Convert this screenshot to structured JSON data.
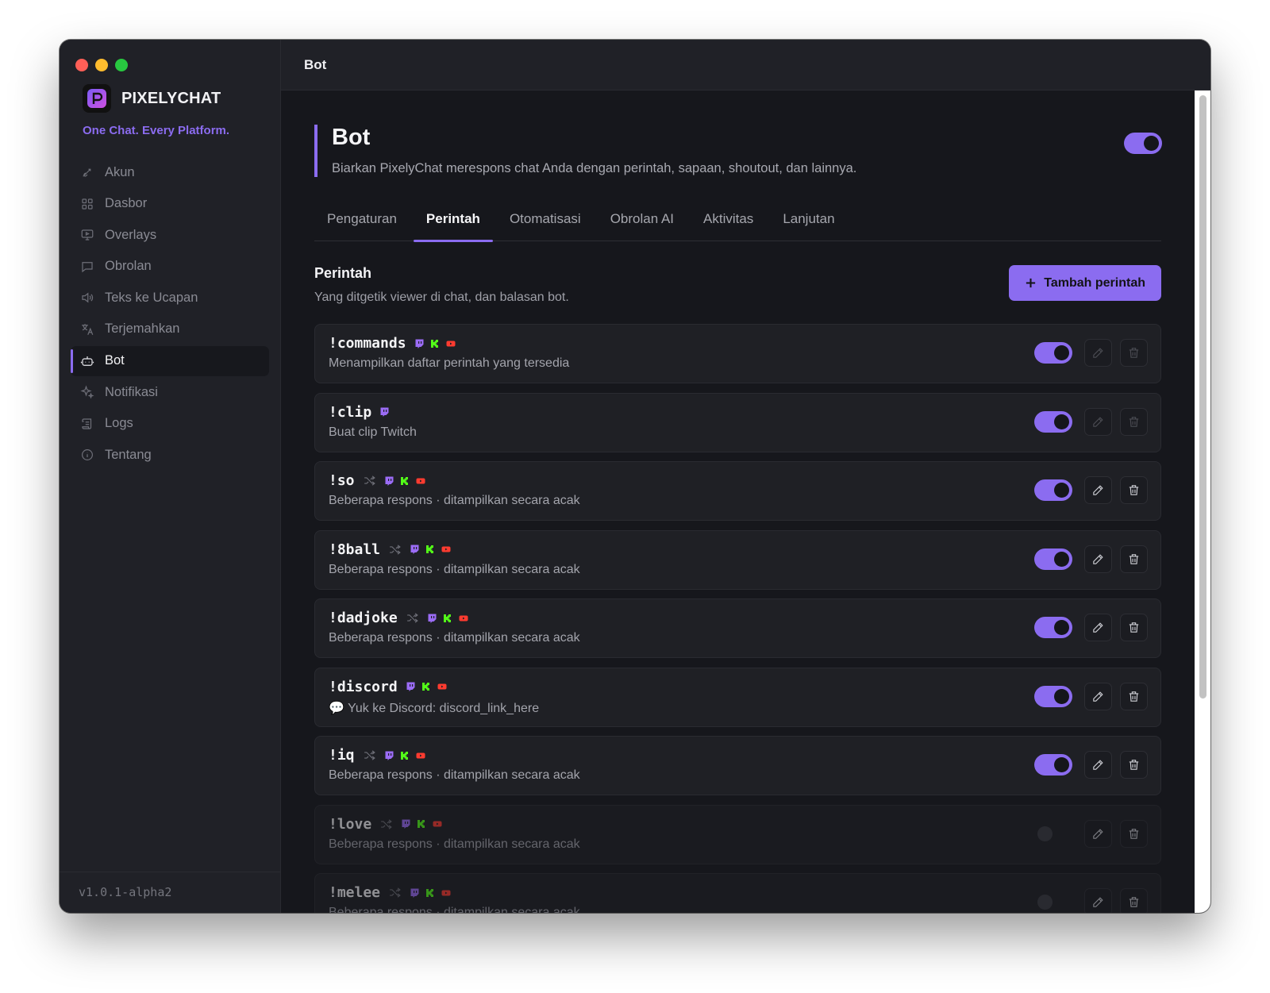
{
  "app": {
    "name": "PIXELYCHAT",
    "tagline": "One Chat. Every Platform.",
    "version": "v1.0.1-alpha2",
    "accent": "#8b6cf0"
  },
  "window": {
    "title": "Bot"
  },
  "sidebar": {
    "items": [
      {
        "label": "Akun",
        "icon": "link-icon"
      },
      {
        "label": "Dasbor",
        "icon": "dashboard-icon"
      },
      {
        "label": "Overlays",
        "icon": "monitor-icon"
      },
      {
        "label": "Obrolan",
        "icon": "chat-bubble-icon"
      },
      {
        "label": "Teks ke Ucapan",
        "icon": "speaker-icon"
      },
      {
        "label": "Terjemahkan",
        "icon": "translate-icon"
      },
      {
        "label": "Bot",
        "icon": "bot-icon",
        "active": true
      },
      {
        "label": "Notifikasi",
        "icon": "sparkle-icon"
      },
      {
        "label": "Logs",
        "icon": "scroll-icon"
      },
      {
        "label": "Tentang",
        "icon": "info-icon"
      }
    ]
  },
  "page": {
    "title": "Bot",
    "description": "Biarkan PixelyChat merespons chat Anda dengan perintah, sapaan, shoutout, dan lainnya.",
    "enabled": true
  },
  "tabs": [
    {
      "label": "Pengaturan"
    },
    {
      "label": "Perintah",
      "active": true
    },
    {
      "label": "Otomatisasi"
    },
    {
      "label": "Obrolan AI"
    },
    {
      "label": "Aktivitas"
    },
    {
      "label": "Lanjutan"
    }
  ],
  "section": {
    "title": "Perintah",
    "subtitle": "Yang ditgetik viewer di chat, dan balasan bot.",
    "add_button": "Tambah perintah"
  },
  "commands": [
    {
      "name": "!commands",
      "desc": "Menampilkan daftar perintah yang tersedia",
      "random": false,
      "platforms": [
        "twitch",
        "kick",
        "youtube"
      ],
      "enabled": true,
      "editable": false
    },
    {
      "name": "!clip",
      "desc": "Buat clip Twitch",
      "random": false,
      "platforms": [
        "twitch"
      ],
      "enabled": true,
      "editable": false
    },
    {
      "name": "!so",
      "desc": "Beberapa respons · ditampilkan secara acak",
      "random": true,
      "platforms": [
        "twitch",
        "kick",
        "youtube"
      ],
      "enabled": true,
      "editable": true
    },
    {
      "name": "!8ball",
      "desc": "Beberapa respons · ditampilkan secara acak",
      "random": true,
      "platforms": [
        "twitch",
        "kick",
        "youtube"
      ],
      "enabled": true,
      "editable": true
    },
    {
      "name": "!dadjoke",
      "desc": "Beberapa respons · ditampilkan secara acak",
      "random": true,
      "platforms": [
        "twitch",
        "kick",
        "youtube"
      ],
      "enabled": true,
      "editable": true
    },
    {
      "name": "!discord",
      "desc": "💬 Yuk ke Discord: discord_link_here",
      "random": false,
      "platforms": [
        "twitch",
        "kick",
        "youtube"
      ],
      "enabled": true,
      "editable": true
    },
    {
      "name": "!iq",
      "desc": "Beberapa respons · ditampilkan secara acak",
      "random": true,
      "platforms": [
        "twitch",
        "kick",
        "youtube"
      ],
      "enabled": true,
      "editable": true
    },
    {
      "name": "!love",
      "desc": "Beberapa respons · ditampilkan secara acak",
      "random": true,
      "platforms": [
        "twitch",
        "kick",
        "youtube"
      ],
      "enabled": false,
      "editable": true
    },
    {
      "name": "!melee",
      "desc": "Beberapa respons · ditampilkan secara acak",
      "random": true,
      "platforms": [
        "twitch",
        "kick",
        "youtube"
      ],
      "enabled": false,
      "editable": true
    }
  ],
  "platform_colors": {
    "twitch": "#9b6cf6",
    "kick": "#53fc18",
    "youtube": "#ff3b30"
  }
}
